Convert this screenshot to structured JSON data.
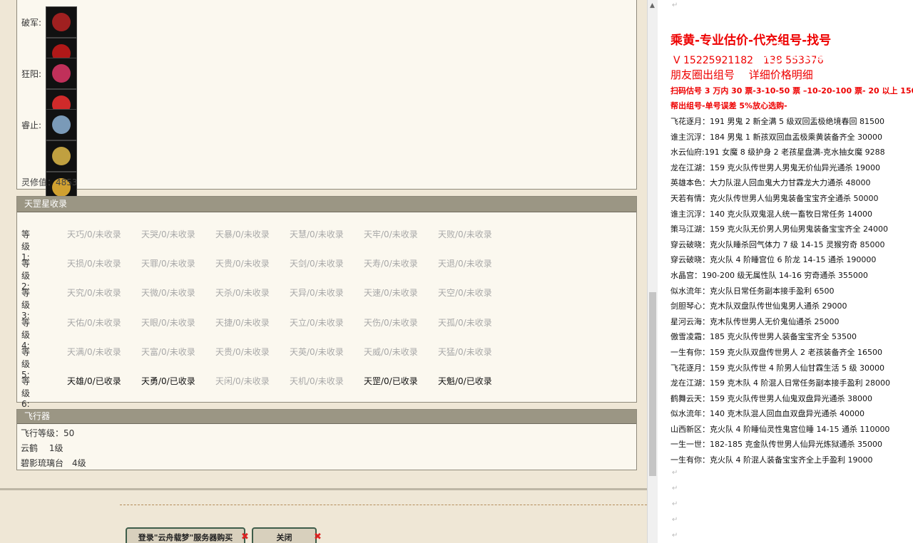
{
  "equipment": {
    "rows": [
      {
        "label": "破军:",
        "icons": [
          "helmet-icon",
          "necklace-icon",
          "armor-icon",
          "mask-icon",
          "crown-icon"
        ],
        "colors": [
          "#a02020",
          "#b01818",
          "#c02424",
          "#c06020",
          "#c0903a"
        ]
      },
      {
        "label": "狂阳:",
        "icons": [
          "necklace-icon",
          "ring-icon",
          "pendant-icon"
        ],
        "colors": [
          "#c0305a",
          "#d02a2a",
          "#d04a1a"
        ]
      },
      {
        "label": "睿止:",
        "icons": [
          "armor-icon",
          "weapon-icon",
          "bowl-icon",
          "glove-icon",
          "mask-icon"
        ],
        "colors": [
          "#7a9ab8",
          "#c0a040",
          "#d0a030",
          "#4a78c0",
          "#5aa8d8"
        ]
      }
    ],
    "lingxiu": "灵修值：4853"
  },
  "tiangang": {
    "title": "天罡星收录",
    "levels": [
      {
        "label": "等级1:",
        "items": [
          {
            "text": "天巧/0/未收录",
            "on": false
          },
          {
            "text": "天哭/0/未收录",
            "on": false
          },
          {
            "text": "天暴/0/未收录",
            "on": false
          },
          {
            "text": "天慧/0/未收录",
            "on": false
          },
          {
            "text": "天牢/0/未收录",
            "on": false
          },
          {
            "text": "天败/0/未收录",
            "on": false
          }
        ]
      },
      {
        "label": "等级2:",
        "items": [
          {
            "text": "天损/0/未收录",
            "on": false
          },
          {
            "text": "天罪/0/未收录",
            "on": false
          },
          {
            "text": "天贵/0/未收录",
            "on": false
          },
          {
            "text": "天剑/0/未收录",
            "on": false
          },
          {
            "text": "天寿/0/未收录",
            "on": false
          },
          {
            "text": "天退/0/未收录",
            "on": false
          }
        ]
      },
      {
        "label": "等级3:",
        "items": [
          {
            "text": "天究/0/未收录",
            "on": false
          },
          {
            "text": "天微/0/未收录",
            "on": false
          },
          {
            "text": "天杀/0/未收录",
            "on": false
          },
          {
            "text": "天异/0/未收录",
            "on": false
          },
          {
            "text": "天速/0/未收录",
            "on": false
          },
          {
            "text": "天空/0/未收录",
            "on": false
          }
        ]
      },
      {
        "label": "等级4:",
        "items": [
          {
            "text": "天佑/0/未收录",
            "on": false
          },
          {
            "text": "天眼/0/未收录",
            "on": false
          },
          {
            "text": "天捷/0/未收录",
            "on": false
          },
          {
            "text": "天立/0/未收录",
            "on": false
          },
          {
            "text": "天伤/0/未收录",
            "on": false
          },
          {
            "text": "天孤/0/未收录",
            "on": false
          }
        ]
      },
      {
        "label": "等级5:",
        "items": [
          {
            "text": "天满/0/未收录",
            "on": false
          },
          {
            "text": "天富/0/未收录",
            "on": false
          },
          {
            "text": "天贵/0/未收录",
            "on": false
          },
          {
            "text": "天英/0/未收录",
            "on": false
          },
          {
            "text": "天威/0/未收录",
            "on": false
          },
          {
            "text": "天猛/0/未收录",
            "on": false
          }
        ]
      },
      {
        "label": "等级6:",
        "items": [
          {
            "text": "天雄/0/已收录",
            "on": true
          },
          {
            "text": "天勇/0/已收录",
            "on": true
          },
          {
            "text": "天闲/0/未收录",
            "on": false
          },
          {
            "text": "天机/0/未收录",
            "on": false
          },
          {
            "text": "天罡/0/已收录",
            "on": true
          },
          {
            "text": "天魁/0/已收录",
            "on": true
          }
        ]
      }
    ]
  },
  "aircraft": {
    "title": "飞行器",
    "lines": [
      "飞行等级：50",
      "云鹤　 1级",
      "碧影琉璃台　4级"
    ]
  },
  "buttons": {
    "login": "登录\"云舟载梦\"服务器购买",
    "close": "关闭",
    "x": "✖"
  },
  "right_panel": {
    "title": "乘黄-专业估价-代充组号-找号",
    "phone": "V 15225921182　138 553376",
    "sub": "朋友圈出组号　 详细价格明细",
    "red1": "扫码估号 3 万内 30 票-3-10-50 票 –10-20-100 票- 20 以上 150",
    "red2": "帮出组号-单号误差 5%放心选购-",
    "watermark": "CC直播",
    "items": [
      "飞花逐月：191 男鬼 2 新全满 5 级双回盂极绝境春回 81500",
      "谁主沉浮：184 男鬼 1 新孩双回血盂极乘黄装备齐全 30000",
      "水云仙府:191 女魔 8 级护身 2 老孩星盘满-克水抽女魔 9288",
      "龙在江湖：159 克火队传世男人男鬼无价仙异光通杀 19000",
      "英雄本色：大力队混人回血鬼大力甘霖龙大力通杀 48000",
      "天若有情：克火队传世男人仙男鬼装备宝宝齐全通杀 50000",
      "谁主沉浮：140 克火队双鬼混人统一畜牧日常任务 14000",
      "策马江湖：159 克火队无价男人男仙男鬼装备宝宝齐全 24000",
      "穿云破晓：克火队睡杀回气体力 7 级 14-15 灵猴穷奇 85000",
      "穿云破晓：克火队 4 阶睡宫位 6 阶龙 14-15 通杀 190000",
      "水晶宫：190-200 级无属性队 14-16 穷奇通杀 355000",
      "似水流年：克火队日常任务副本接手盈利 6500",
      "剑胆琴心：克木队双盘队传世仙鬼男人通杀 29000",
      "星河云海：克木队传世男人无价鬼仙通杀 25000",
      "傲雪凌霜：185 克火队传世男人装备宝宝齐全 53500",
      "一生有你：159 克火队双盘传世男人 2 老孩装备齐全 16500",
      "飞花逐月：159 克火队传世 4 阶男人仙甘霖生活 5 级 30000",
      "龙在江湖：159 克木队 4 阶混人日常任务副本接手盈利 28000",
      "鹤舞云天：159 克火队传世男人仙鬼双盘异光通杀 38000",
      "似水流年：140 克木队混人回血血双盘异光通杀 40000",
      "山西新区：克火队 4 阶睡仙灵性鬼宫位睡 14-15 通杀 110000",
      "一生一世：182-185 克金队传世男人仙异光炼狱通杀 35000",
      "一生有你：克火队 4 阶混人装备宝宝齐全上手盈利 19000"
    ],
    "para_mark": "↵"
  }
}
